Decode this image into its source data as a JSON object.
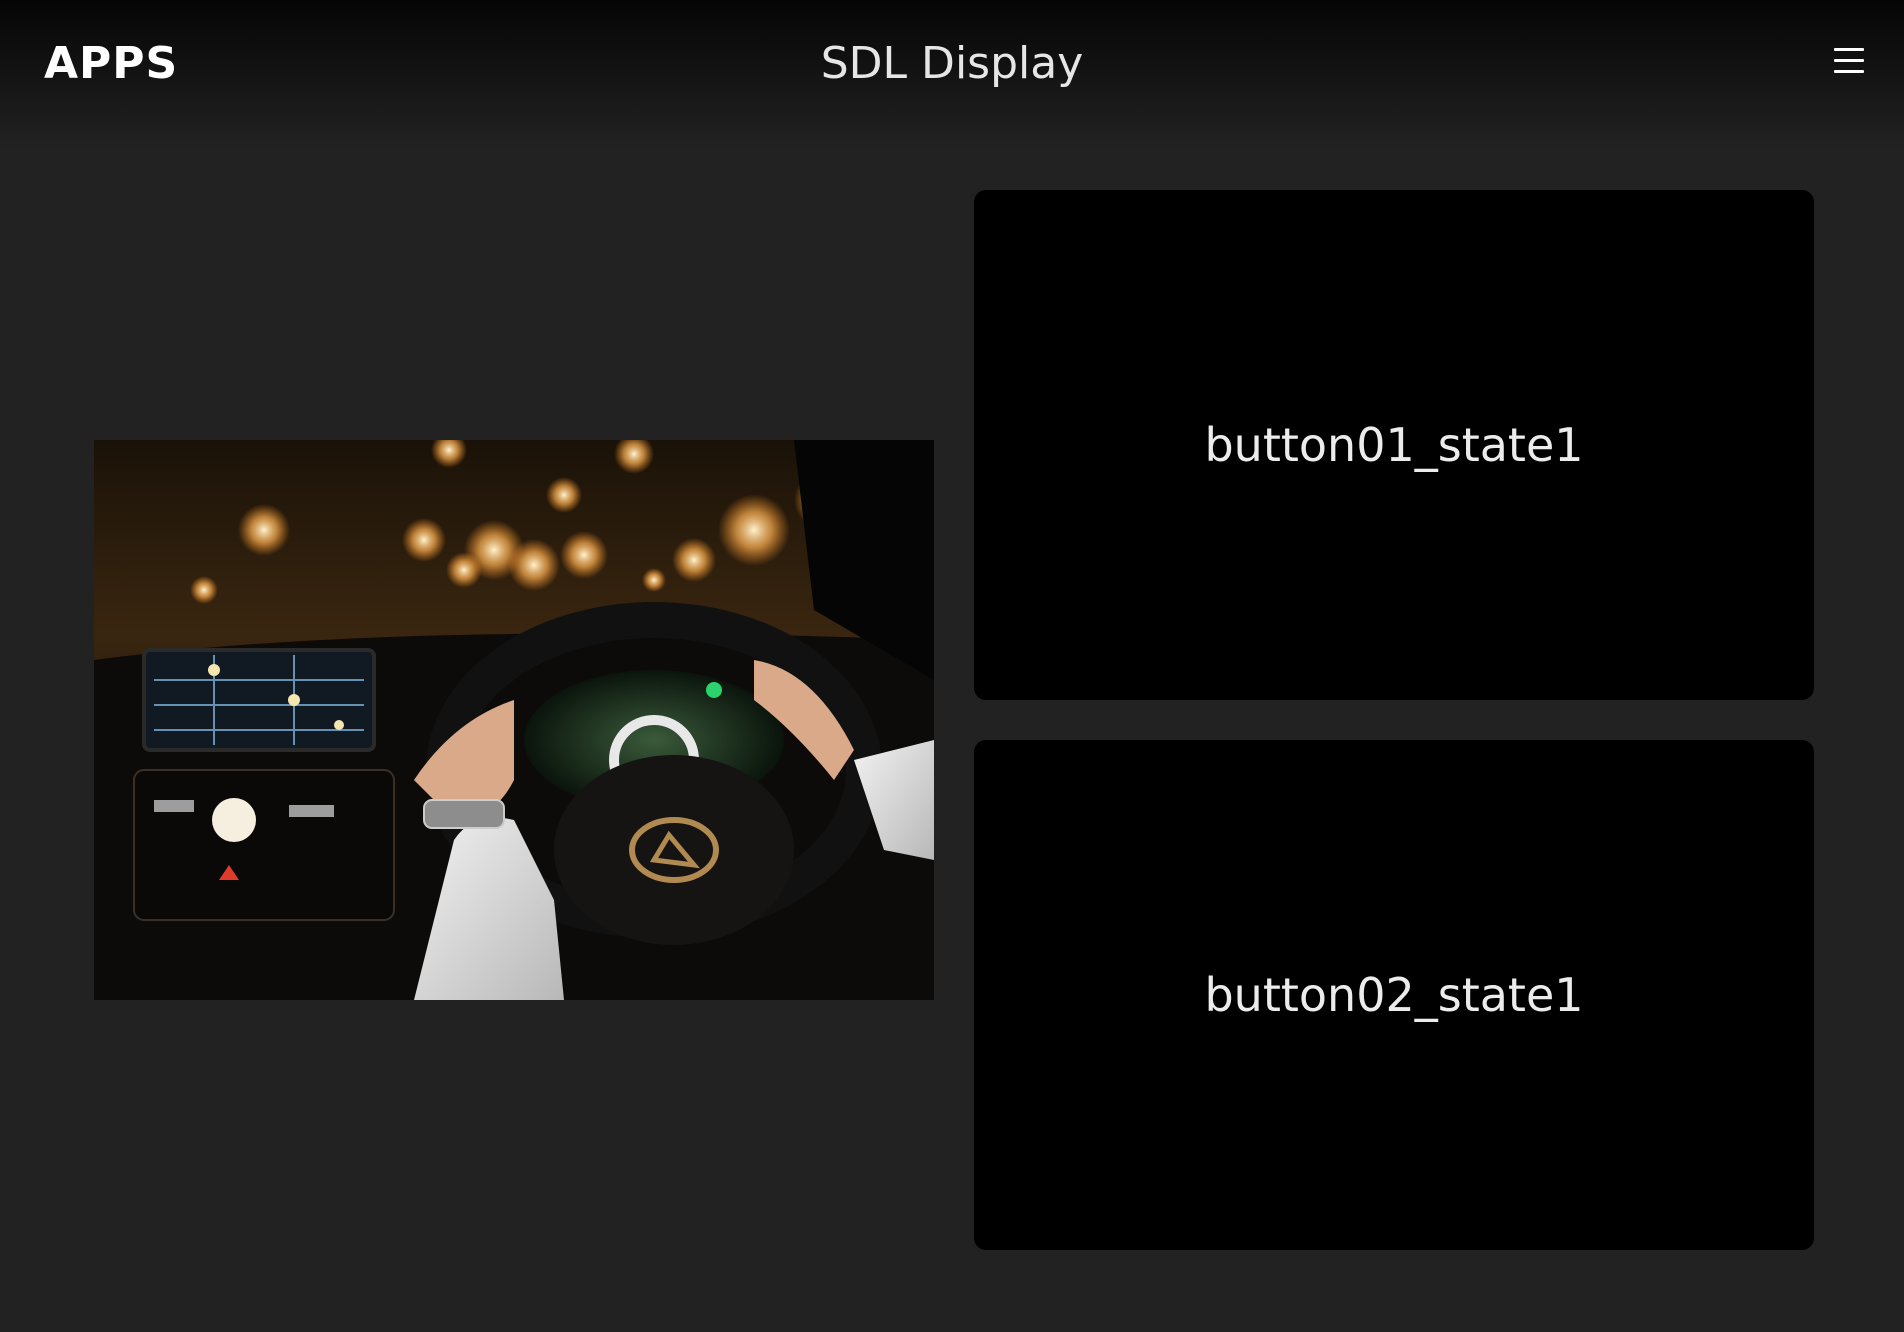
{
  "header": {
    "apps_label": "APPS",
    "title": "SDL Display",
    "menu_icon": "hamburger-menu-icon"
  },
  "main": {
    "graphic": {
      "description_icon": "car-interior-night-photo"
    },
    "soft_buttons": [
      {
        "label": "button01_state1"
      },
      {
        "label": "button02_state1"
      }
    ]
  },
  "colors": {
    "background": "#222222",
    "header_top": "#050505",
    "button_bg": "#000000",
    "text": "#ececec"
  }
}
